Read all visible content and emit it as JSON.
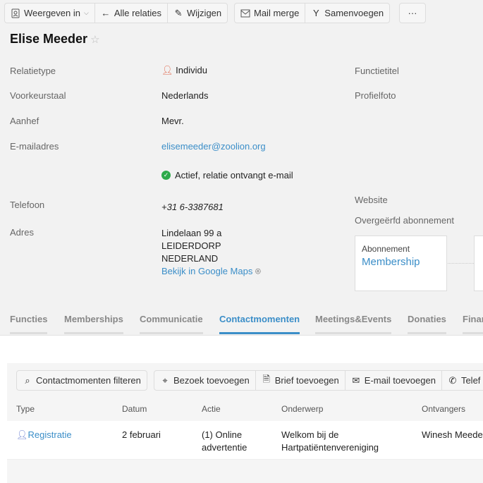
{
  "toolbar": {
    "view_in": "Weergeven in",
    "all_relations": "Alle relaties",
    "edit": "Wijzigen",
    "mail_merge": "Mail merge",
    "merge": "Samenvoegen",
    "more": "···"
  },
  "contact": {
    "name": "Elise Meeder"
  },
  "fields": {
    "relation_type_label": "Relatietype",
    "relation_type": "Individu",
    "language_label": "Voorkeurstaal",
    "language": "Nederlands",
    "salutation_label": "Aanhef",
    "salutation": "Mevr.",
    "email_label": "E-mailadres",
    "email": "elisemeeder@zoolion.org",
    "email_status": "Actief, relatie ontvangt e-mail",
    "phone_label": "Telefoon",
    "phone": "+31 6-3387681",
    "address_label": "Adres",
    "address_lines": [
      "Lindelaan 99 a",
      "LEIDERDORP",
      "NEDERLAND"
    ],
    "maps_link": "Bekijk in Google Maps",
    "job_title_label": "Functietitel",
    "photo_label": "Profielfoto",
    "website_label": "Website",
    "inherited_label": "Overgeërfd abonnement"
  },
  "subscription_card": {
    "heading": "Abonnement",
    "link": "Membership"
  },
  "tabs": [
    "Functies",
    "Memberships",
    "Communicatie",
    "Contactmomenten",
    "Meetings&Events",
    "Donaties",
    "Finan"
  ],
  "active_tab": "Contactmomenten",
  "table_toolbar": {
    "filter": "Contactmomenten filteren",
    "visit": "Bezoek toevoegen",
    "letter": "Brief toevoegen",
    "email": "E-mail toevoegen",
    "phone": "Telef"
  },
  "table": {
    "columns": [
      "Type",
      "Datum",
      "Actie",
      "Onderwerp",
      "Ontvangers"
    ],
    "rows": [
      {
        "type": "Registratie",
        "date": "2 februari",
        "action": "(1) Online advertentie",
        "subject": "Welkom bij de Hartpatiëntenvereniging",
        "recipients": "Winesh Meeder"
      }
    ]
  },
  "colors": {
    "accent": "#3b8ec8",
    "success": "#2eaa4a",
    "person_icon": "#e0654a"
  }
}
